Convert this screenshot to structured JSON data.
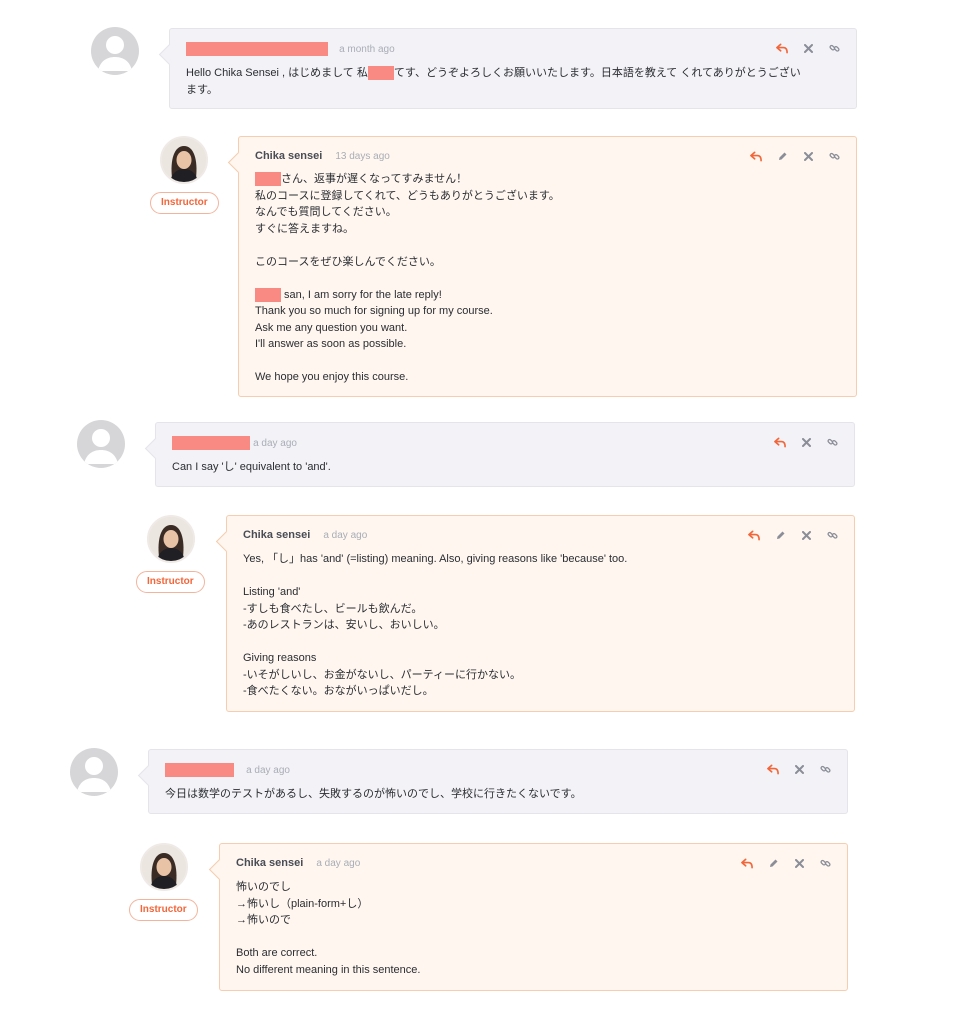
{
  "colors": {
    "accent": "#f2663a",
    "redaction": "#f88a83",
    "student_bg": "#f3f3f7",
    "teacher_bg": "#fef6ef"
  },
  "icons": {
    "reply": "reply-icon",
    "edit": "pencil-icon",
    "delete": "close-icon",
    "link": "link-icon"
  },
  "comments": [
    {
      "author": "",
      "time": "a month ago",
      "lines_a": "Hello Chika Sensei , はじめまして 私",
      "lines_a2": "てす、どうぞよろしくお願いいたします。日本語を教えて くれてありがとうござい",
      "lines_b": "ます。"
    },
    {
      "author": "Chika sensei",
      "time": "13 days ago",
      "badge": "Instructor",
      "line1_suffix": "さん、返事が遅くなってすみません！",
      "lines": [
        "私のコースに登録してくれて、どうもありがとうございます。",
        "なんでも質問してください。",
        "すぐに答えますね。",
        "",
        "このコースをぜひ楽しんでください。",
        ""
      ],
      "line_en1_suffix": " san, I am sorry for the late reply!",
      "lines_en": [
        "Thank you so much for signing up for my course.",
        "Ask me any question you want.",
        "I'll answer as soon as possible.",
        "",
        "We hope you enjoy this course."
      ]
    },
    {
      "author": "",
      "time": "a day ago",
      "lines": [
        "Can I say 'し' equivalent to 'and'."
      ]
    },
    {
      "author": "Chika sensei",
      "time": "a day ago",
      "badge": "Instructor",
      "lines": [
        "Yes, 「し」has 'and' (=listing) meaning. Also, giving reasons like 'because' too.",
        "",
        "Listing 'and'",
        "-すしも食べたし、ビールも飲んだ。",
        "-あのレストランは、安いし、おいしい。",
        "",
        "Giving reasons",
        "-いそがしいし、お金がないし、パーティーに行かない。",
        "-食べたくない。おながいっぱいだし。"
      ]
    },
    {
      "author": "",
      "time": "a day ago",
      "lines": [
        "今日は数学のテストがあるし、失敗するのが怖いのでし、学校に行きたくないです。"
      ]
    },
    {
      "author": "Chika sensei",
      "time": "a day ago",
      "badge": "Instructor",
      "lines": [
        "怖いのでし",
        "→怖いし（plain-form+し）",
        "→怖いので",
        "",
        "Both are correct.",
        "No different meaning in this sentence."
      ]
    }
  ]
}
